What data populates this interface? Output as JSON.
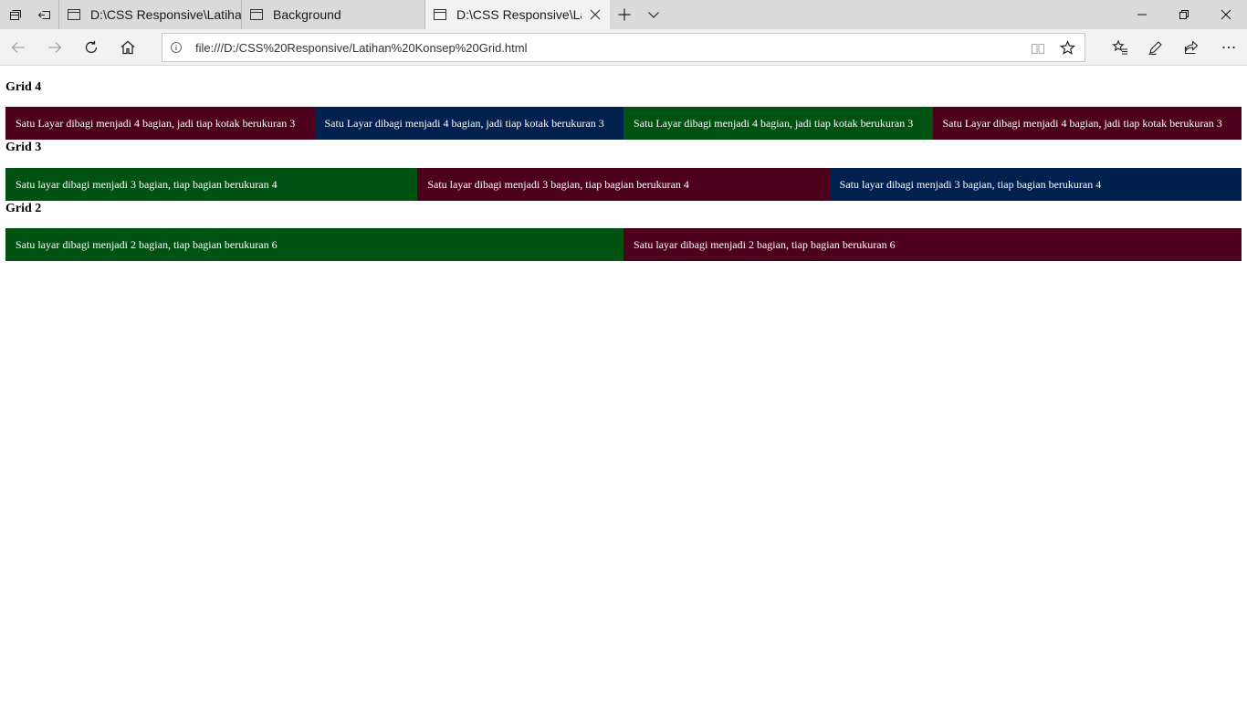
{
  "tabs": [
    {
      "label": "D:\\CSS Responsive\\Latihan I"
    },
    {
      "label": "Background"
    },
    {
      "label": "D:\\CSS Responsive\\Latih"
    }
  ],
  "address_bar": {
    "url": "file:///D:/CSS%20Responsive/Latihan%20Konsep%20Grid.html"
  },
  "colors": {
    "maroon": "#4d001c",
    "navy": "#00204f",
    "green": "#005213"
  },
  "sections": [
    {
      "heading": "Grid 4",
      "cells": [
        {
          "text": "Satu Layar dibagi menjadi 4 bagian, jadi tiap kotak berukuran 3",
          "color": "maroon"
        },
        {
          "text": "Satu Layar dibagi menjadi 4 bagian, jadi tiap kotak berukuran 3",
          "color": "navy"
        },
        {
          "text": "Satu Layar dibagi menjadi 4 bagian, jadi tiap kotak berukuran 3",
          "color": "green"
        },
        {
          "text": "Satu Layar dibagi menjadi 4 bagian, jadi tiap kotak berukuran 3",
          "color": "maroon"
        }
      ]
    },
    {
      "heading": "Grid 3",
      "cells": [
        {
          "text": "Satu layar dibagi menjadi 3 bagian, tiap bagian berukuran 4",
          "color": "green"
        },
        {
          "text": "Satu layar dibagi menjadi 3 bagian, tiap bagian berukuran 4",
          "color": "maroon"
        },
        {
          "text": "Satu layar dibagi menjadi 3 bagian, tiap bagian berukuran 4",
          "color": "navy"
        }
      ]
    },
    {
      "heading": "Grid 2",
      "cells": [
        {
          "text": "Satu layar dibagi menjadi 2 bagian, tiap bagian berukuran 6",
          "color": "green"
        },
        {
          "text": "Satu layar dibagi menjadi 2 bagian, tiap bagian berukuran 6",
          "color": "maroon"
        }
      ]
    }
  ],
  "icons": {
    "tab_actions": [
      "tabs-aside-icon",
      "restore-tabs-icon"
    ],
    "tab_controls": [
      "new-tab-icon",
      "tab-preview-icon"
    ],
    "nav": [
      "back-icon",
      "forward-icon",
      "refresh-icon",
      "home-icon"
    ],
    "address": [
      "info-icon",
      "reading-view-icon",
      "favorite-star-icon"
    ],
    "toolbar": [
      "favorites-icon",
      "web-note-icon",
      "share-icon",
      "more-icon"
    ],
    "window": [
      "minimize-icon",
      "restore-icon",
      "close-icon"
    ]
  }
}
